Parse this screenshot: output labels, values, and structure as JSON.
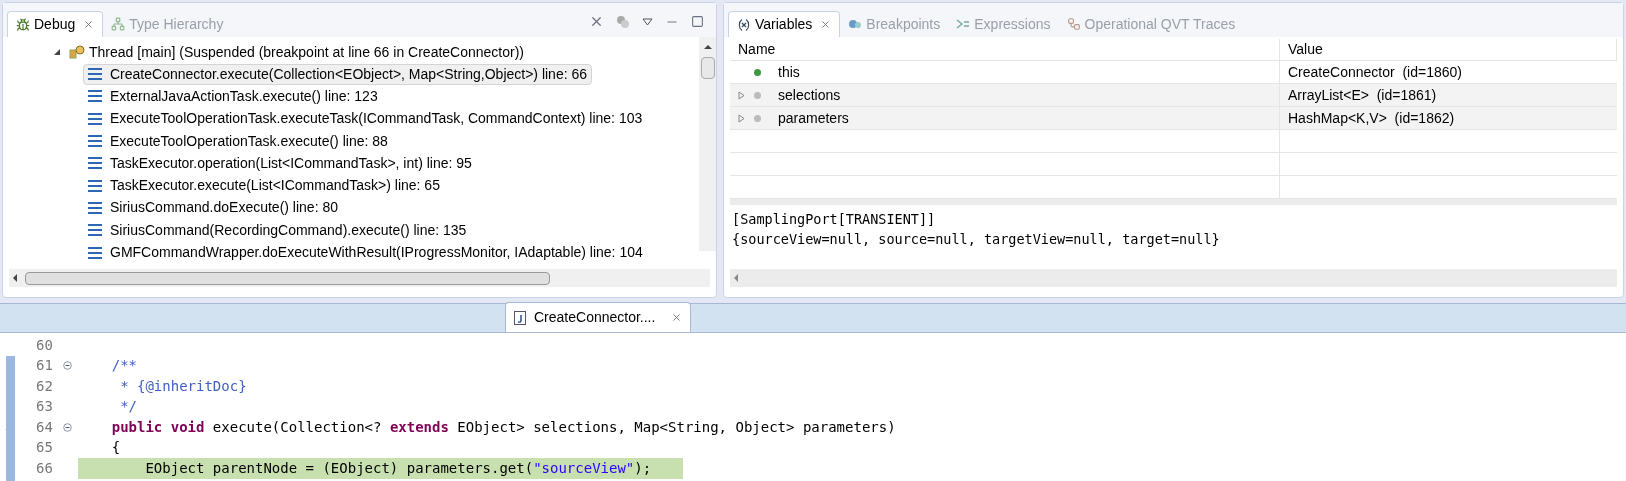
{
  "debug_view": {
    "tabs": [
      {
        "label": "Debug",
        "selected": true
      },
      {
        "label": "Type Hierarchy",
        "selected": false
      }
    ],
    "thread": {
      "label": "Thread [main] (Suspended (breakpoint at line 66 in CreateConnector))",
      "expanded": true
    },
    "frames": [
      {
        "label": "CreateConnector.execute(Collection<EObject>, Map<String,Object>) line: 66",
        "selected": true
      },
      {
        "label": "ExternalJavaActionTask.execute() line: 123",
        "selected": false
      },
      {
        "label": "ExecuteToolOperationTask.executeTask(ICommandTask, CommandContext) line: 103",
        "selected": false
      },
      {
        "label": "ExecuteToolOperationTask.execute() line: 88",
        "selected": false
      },
      {
        "label": "TaskExecutor.operation(List<ICommandTask>, int) line: 95",
        "selected": false
      },
      {
        "label": "TaskExecutor.execute(List<ICommandTask>) line: 65",
        "selected": false
      },
      {
        "label": "SiriusCommand.doExecute() line: 80",
        "selected": false
      },
      {
        "label": "SiriusCommand(RecordingCommand).execute() line: 135",
        "selected": false
      },
      {
        "label": "GMFCommandWrapper.doExecuteWithResult(IProgressMonitor, IAdaptable) line: 104",
        "selected": false
      }
    ]
  },
  "variables_view": {
    "tabs": [
      {
        "label": "Variables",
        "selected": true
      },
      {
        "label": "Breakpoints",
        "selected": false
      },
      {
        "label": "Expressions",
        "selected": false
      },
      {
        "label": "Operational QVT Traces",
        "selected": false
      }
    ],
    "columns": [
      "Name",
      "Value"
    ],
    "rows": [
      {
        "name": "this",
        "value": "CreateConnector  (id=1860)",
        "kind": "this",
        "expandable": false
      },
      {
        "name": "selections",
        "value": "ArrayList<E>  (id=1861)",
        "kind": "local",
        "expandable": true
      },
      {
        "name": "parameters",
        "value": "HashMap<K,V>  (id=1862)",
        "kind": "local",
        "expandable": true
      }
    ],
    "detail": [
      "[SamplingPort[TRANSIENT]]",
      "{sourceView=null, source=null, targetView=null, target=null}"
    ]
  },
  "editor": {
    "tab": {
      "label": "CreateConnector....",
      "selected": true
    },
    "lines": [
      {
        "number": "60",
        "fold": false,
        "kind": "normal",
        "current": false
      },
      {
        "number": "61",
        "fold": true,
        "kind": "normal",
        "current": false,
        "segments": [
          {
            "kind": "comment",
            "text": "    /**"
          }
        ]
      },
      {
        "number": "62",
        "fold": false,
        "kind": "normal",
        "current": false,
        "segments": [
          {
            "kind": "comment",
            "text": "     * "
          },
          {
            "kind": "doctag",
            "text": "{@inheritDoc}"
          }
        ]
      },
      {
        "number": "63",
        "fold": false,
        "kind": "normal",
        "current": false,
        "segments": [
          {
            "kind": "comment",
            "text": "     */"
          }
        ]
      },
      {
        "number": "64",
        "fold": true,
        "kind": "override",
        "current": false,
        "segments": [
          {
            "kind": "keyword",
            "text": "    public void"
          },
          {
            "kind": "plain",
            "text": " execute(Collection<? "
          },
          {
            "kind": "keyword",
            "text": "extends"
          },
          {
            "kind": "plain",
            "text": " EObject> selections, Map<String, Object> parameters)"
          }
        ]
      },
      {
        "number": "65",
        "fold": false,
        "kind": "normal",
        "current": false,
        "segments": [
          {
            "kind": "plain",
            "text": "    {"
          }
        ]
      },
      {
        "number": "66",
        "fold": false,
        "kind": "pointer",
        "current": true,
        "segments": [
          {
            "kind": "plain",
            "text": "        EObject parentNode = (EObject) parameters.get("
          },
          {
            "kind": "string",
            "text": "\"sourceView\""
          },
          {
            "kind": "plain",
            "text": ");"
          }
        ]
      }
    ]
  }
}
